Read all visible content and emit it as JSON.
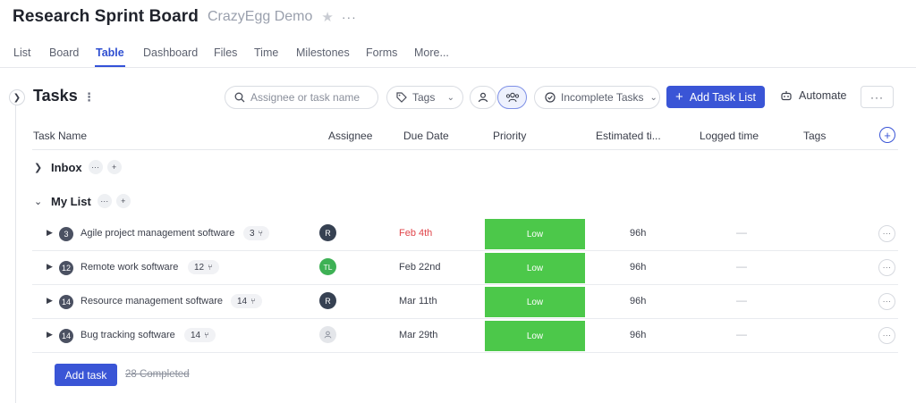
{
  "header": {
    "title": "Research Sprint Board",
    "workspace": "CrazyEgg Demo",
    "star_icon": "star-icon",
    "more_icon": "more-horizontal-icon"
  },
  "tabs": [
    {
      "label": "List",
      "active": false
    },
    {
      "label": "Board",
      "active": false
    },
    {
      "label": "Table",
      "active": true
    },
    {
      "label": "Dashboard",
      "active": false
    },
    {
      "label": "Files",
      "active": false
    },
    {
      "label": "Time",
      "active": false
    },
    {
      "label": "Milestones",
      "active": false
    },
    {
      "label": "Forms",
      "active": false
    },
    {
      "label": "More...",
      "active": false
    }
  ],
  "toolbar": {
    "heading": "Tasks",
    "search_placeholder": "Assignee or task name",
    "tags_label": "Tags",
    "status_filter": "Incomplete Tasks",
    "add_list_label": "Add Task List",
    "automate_label": "Automate"
  },
  "columns": {
    "task_name": "Task Name",
    "assignee": "Assignee",
    "due_date": "Due Date",
    "priority": "Priority",
    "estimated": "Estimated ti...",
    "logged": "Logged time",
    "tags": "Tags"
  },
  "groups": [
    {
      "name": "Inbox",
      "expanded": false
    },
    {
      "name": "My List",
      "expanded": true
    }
  ],
  "tasks": [
    {
      "num": "3",
      "name": "Agile project management software",
      "subtasks": "3",
      "assignee": "R",
      "due": "Feb 4th",
      "overdue": true,
      "priority": "Low",
      "estimated": "96h",
      "logged": "—"
    },
    {
      "num": "12",
      "name": "Remote work software",
      "subtasks": "12",
      "assignee": "TL",
      "due": "Feb 22nd",
      "overdue": false,
      "priority": "Low",
      "estimated": "96h",
      "logged": "—"
    },
    {
      "num": "14",
      "name": "Resource management software",
      "subtasks": "14",
      "assignee": "R",
      "due": "Mar 11th",
      "overdue": false,
      "priority": "Low",
      "estimated": "96h",
      "logged": "—"
    },
    {
      "num": "14",
      "name": "Bug tracking software",
      "subtasks": "14",
      "assignee": "",
      "due": "Mar 29th",
      "overdue": false,
      "priority": "Low",
      "estimated": "96h",
      "logged": "—"
    }
  ],
  "footer": {
    "add_task_label": "Add task",
    "completed_label": "28 Completed"
  },
  "colors": {
    "accent": "#3a55d6",
    "priority_low": "#4cc84a",
    "overdue": "#e0454a"
  }
}
